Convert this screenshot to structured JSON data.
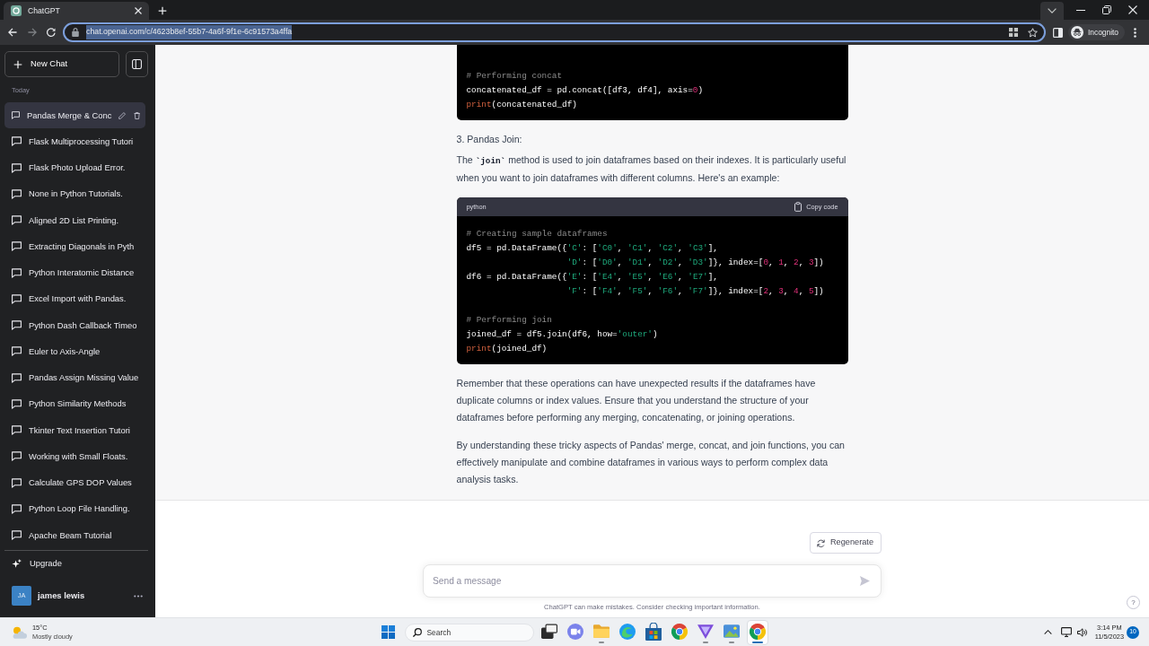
{
  "browser": {
    "tabs": [
      {
        "title": "ChatGPT",
        "selected": true
      }
    ],
    "address_bar": {
      "url": "chat.openai.com/c/4623b8ef-55b7-4a6f-9f1e-6c91573a4ffa",
      "focused": true,
      "url_selected": true
    },
    "profile": {
      "label": "Incognito"
    }
  },
  "sidebar": {
    "new_chat": {
      "label": "New Chat"
    },
    "section_label": "Today",
    "items": [
      {
        "title": "Pandas Merge & Conc",
        "selected": true
      },
      {
        "title": "Flask Multiprocessing Tutori",
        "selected": false
      },
      {
        "title": "Flask Photo Upload Error.",
        "selected": false
      },
      {
        "title": "None in Python Tutorials.",
        "selected": false
      },
      {
        "title": "Aligned 2D List Printing.",
        "selected": false
      },
      {
        "title": "Extracting Diagonals in Pyth",
        "selected": false
      },
      {
        "title": "Python Interatomic Distance",
        "selected": false
      },
      {
        "title": "Excel Import with Pandas.",
        "selected": false
      },
      {
        "title": "Python Dash Callback Timeo",
        "selected": false
      },
      {
        "title": "Euler to Axis-Angle",
        "selected": false
      },
      {
        "title": "Pandas Assign Missing Value",
        "selected": false
      },
      {
        "title": "Python Similarity Methods",
        "selected": false
      },
      {
        "title": "Tkinter Text Insertion Tutori",
        "selected": false
      },
      {
        "title": "Working with Small Floats.",
        "selected": false
      },
      {
        "title": "Calculate GPS DOP Values",
        "selected": false
      },
      {
        "title": "Python Loop File Handling.",
        "selected": false
      },
      {
        "title": "Apache Beam Tutorial",
        "selected": false
      }
    ],
    "upgrade": {
      "label": "Upgrade"
    },
    "user": {
      "initials": "JA",
      "name": "james lewis"
    }
  },
  "conversation": {
    "blocks": [
      {
        "kind": "code",
        "sections": [
          [
            {
              "continued": false,
              "tokens": [
                {
                  "kind": "comment",
                  "text": "# Performing concat"
                }
              ]
            },
            {
              "continued": false,
              "tokens": [
                {
                  "kind": "plain",
                  "text": "concatenated_df = pd.concat([df3, df4], axis="
                },
                {
                  "kind": "number",
                  "text": "0"
                },
                {
                  "kind": "plain",
                  "text": ")"
                }
              ]
            },
            {
              "continued": false,
              "tokens": [
                {
                  "kind": "builtin",
                  "text": "print"
                },
                {
                  "kind": "plain",
                  "text": "(concatenated_df)"
                }
              ]
            }
          ]
        ]
      },
      {
        "kind": "list_item",
        "text": "3. Pandas Join:"
      },
      {
        "kind": "paragraph",
        "text": "The **`join`** method is used to join dataframes based on their indexes. It is particularly useful when you want to join dataframes with different columns. Here's an example:"
      },
      {
        "kind": "code",
        "language": "python",
        "copy_label": "Copy code",
        "sections": [
          [
            {
              "continued": false,
              "tokens": [
                {
                  "kind": "comment",
                  "text": "# Creating sample dataframes"
                }
              ]
            },
            {
              "continued": false,
              "tokens": [
                {
                  "kind": "plain",
                  "text": "df5 = pd.DataFrame({"
                },
                {
                  "kind": "string",
                  "text": "'C'"
                },
                {
                  "kind": "plain",
                  "text": ": ["
                },
                {
                  "kind": "string",
                  "text": "'C0'"
                },
                {
                  "kind": "plain",
                  "text": ", "
                },
                {
                  "kind": "string",
                  "text": "'C1'"
                },
                {
                  "kind": "plain",
                  "text": ", "
                },
                {
                  "kind": "string",
                  "text": "'C2'"
                },
                {
                  "kind": "plain",
                  "text": ", "
                },
                {
                  "kind": "string",
                  "text": "'C3'"
                },
                {
                  "kind": "plain",
                  "text": "],"
                }
              ]
            },
            {
              "continued": true,
              "tokens": [
                {
                  "kind": "string",
                  "text": "'D'"
                },
                {
                  "kind": "plain",
                  "text": ": ["
                },
                {
                  "kind": "string",
                  "text": "'D0'"
                },
                {
                  "kind": "plain",
                  "text": ", "
                },
                {
                  "kind": "string",
                  "text": "'D1'"
                },
                {
                  "kind": "plain",
                  "text": ", "
                },
                {
                  "kind": "string",
                  "text": "'D2'"
                },
                {
                  "kind": "plain",
                  "text": ", "
                },
                {
                  "kind": "string",
                  "text": "'D3'"
                },
                {
                  "kind": "plain",
                  "text": "]}, index=["
                },
                {
                  "kind": "number",
                  "text": "0"
                },
                {
                  "kind": "plain",
                  "text": ", "
                },
                {
                  "kind": "number",
                  "text": "1"
                },
                {
                  "kind": "plain",
                  "text": ", "
                },
                {
                  "kind": "number",
                  "text": "2"
                },
                {
                  "kind": "plain",
                  "text": ", "
                },
                {
                  "kind": "number",
                  "text": "3"
                },
                {
                  "kind": "plain",
                  "text": "])"
                }
              ]
            },
            {
              "continued": false,
              "tokens": [
                {
                  "kind": "plain",
                  "text": "df6 = pd.DataFrame({"
                },
                {
                  "kind": "string",
                  "text": "'E'"
                },
                {
                  "kind": "plain",
                  "text": ": ["
                },
                {
                  "kind": "string",
                  "text": "'E4'"
                },
                {
                  "kind": "plain",
                  "text": ", "
                },
                {
                  "kind": "string",
                  "text": "'E5'"
                },
                {
                  "kind": "plain",
                  "text": ", "
                },
                {
                  "kind": "string",
                  "text": "'E6'"
                },
                {
                  "kind": "plain",
                  "text": ", "
                },
                {
                  "kind": "string",
                  "text": "'E7'"
                },
                {
                  "kind": "plain",
                  "text": "],"
                }
              ]
            },
            {
              "continued": true,
              "tokens": [
                {
                  "kind": "string",
                  "text": "'F'"
                },
                {
                  "kind": "plain",
                  "text": ": ["
                },
                {
                  "kind": "string",
                  "text": "'F4'"
                },
                {
                  "kind": "plain",
                  "text": ", "
                },
                {
                  "kind": "string",
                  "text": "'F5'"
                },
                {
                  "kind": "plain",
                  "text": ", "
                },
                {
                  "kind": "string",
                  "text": "'F6'"
                },
                {
                  "kind": "plain",
                  "text": ", "
                },
                {
                  "kind": "string",
                  "text": "'F7'"
                },
                {
                  "kind": "plain",
                  "text": "]}, index=["
                },
                {
                  "kind": "number",
                  "text": "2"
                },
                {
                  "kind": "plain",
                  "text": ", "
                },
                {
                  "kind": "number",
                  "text": "3"
                },
                {
                  "kind": "plain",
                  "text": ", "
                },
                {
                  "kind": "number",
                  "text": "4"
                },
                {
                  "kind": "plain",
                  "text": ", "
                },
                {
                  "kind": "number",
                  "text": "5"
                },
                {
                  "kind": "plain",
                  "text": "])"
                }
              ]
            }
          ],
          [
            {
              "continued": false,
              "tokens": [
                {
                  "kind": "comment",
                  "text": "# Performing join"
                }
              ]
            },
            {
              "continued": false,
              "tokens": [
                {
                  "kind": "plain",
                  "text": "joined_df = df5.join(df6, how="
                },
                {
                  "kind": "string",
                  "text": "'outer'"
                },
                {
                  "kind": "plain",
                  "text": ")"
                }
              ]
            },
            {
              "continued": false,
              "tokens": [
                {
                  "kind": "builtin",
                  "text": "print"
                },
                {
                  "kind": "plain",
                  "text": "(joined_df)"
                }
              ]
            }
          ]
        ]
      },
      {
        "kind": "paragraph",
        "text": "Remember that these operations can have unexpected results if the dataframes have duplicate columns or index values. Ensure that you understand the structure of your dataframes before performing any merging, concatenating, or joining operations."
      },
      {
        "kind": "paragraph",
        "text": "By understanding these tricky aspects of Pandas' merge, concat, and join functions, you can effectively manipulate and combine dataframes in various ways to perform complex data analysis tasks."
      }
    ]
  },
  "regenerate_button": {
    "label": "Regenerate"
  },
  "composer": {
    "placeholder": "Send a message"
  },
  "disclaimer": "ChatGPT can make mistakes. Consider checking important information.",
  "help_button": {
    "label": "?"
  },
  "taskbar": {
    "weather": {
      "temperature": "15°C",
      "condition": "Mostly cloudy"
    },
    "search": {
      "placeholder": "Search"
    },
    "apps": [
      {
        "kind": "window",
        "running": false,
        "active": false
      },
      {
        "kind": "video",
        "running": false,
        "active": false
      },
      {
        "kind": "folder",
        "running": true,
        "active": false
      },
      {
        "kind": "swirl",
        "running": false,
        "active": false
      },
      {
        "kind": "bag",
        "running": false,
        "active": false
      },
      {
        "kind": "tricolor",
        "running": false,
        "active": false
      },
      {
        "kind": "triangle",
        "running": true,
        "active": false
      },
      {
        "kind": "picture",
        "running": true,
        "active": false
      },
      {
        "kind": "tricolor",
        "running": true,
        "active": true
      }
    ],
    "clock": {
      "time": "3:14 PM",
      "date": "11/5/2023"
    },
    "notifications": {
      "count": "10"
    }
  }
}
